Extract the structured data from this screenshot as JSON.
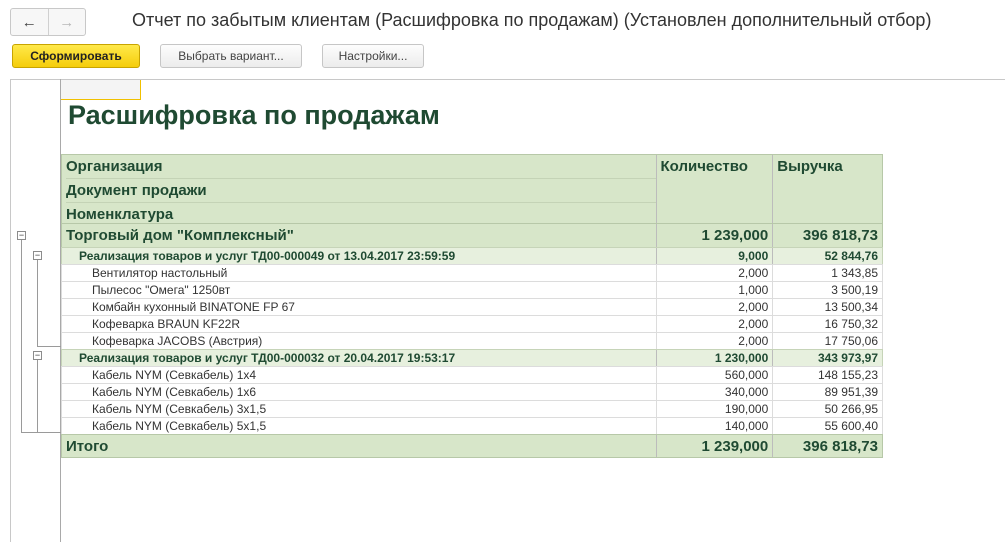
{
  "nav": {
    "back_icon": "arrow-left-icon",
    "forward_icon": "arrow-right-icon",
    "back_glyph": "←",
    "forward_glyph": "→"
  },
  "window": {
    "title": "Отчет по забытым клиентам (Расшифровка по продажам) (Установлен дополнительный отбор)"
  },
  "toolbar": {
    "generate_label": "Сформировать",
    "choose_variant_label": "Выбрать вариант...",
    "settings_label": "Настройки..."
  },
  "report": {
    "title": "Расшифровка по продажам",
    "header": {
      "organization": "Организация",
      "sale_document": "Документ продажи",
      "nomenclature": "Номенклатура",
      "quantity": "Количество",
      "revenue": "Выручка"
    },
    "group": {
      "name": "Торговый дом \"Комплексный\"",
      "quantity": "1 239,000",
      "revenue": "396 818,73"
    },
    "documents": [
      {
        "name": "Реализация товаров и услуг ТД00-000049 от 13.04.2017 23:59:59",
        "quantity": "9,000",
        "revenue": "52 844,76",
        "items": [
          {
            "name": "Вентилятор настольный",
            "quantity": "2,000",
            "revenue": "1 343,85"
          },
          {
            "name": "Пылесос \"Омега\" 1250вт",
            "quantity": "1,000",
            "revenue": "3 500,19"
          },
          {
            "name": "Комбайн кухонный BINATONE FP 67",
            "quantity": "2,000",
            "revenue": "13 500,34"
          },
          {
            "name": "Кофеварка BRAUN KF22R",
            "quantity": "2,000",
            "revenue": "16 750,32"
          },
          {
            "name": "Кофеварка JACOBS (Австрия)",
            "quantity": "2,000",
            "revenue": "17 750,06"
          }
        ]
      },
      {
        "name": "Реализация товаров и услуг ТД00-000032 от 20.04.2017 19:53:17",
        "quantity": "1 230,000",
        "revenue": "343 973,97",
        "items": [
          {
            "name": "Кабель NYM (Севкабель) 1х4",
            "quantity": "560,000",
            "revenue": "148 155,23"
          },
          {
            "name": "Кабель NYM (Севкабель) 1х6",
            "quantity": "340,000",
            "revenue": "89 951,39"
          },
          {
            "name": "Кабель NYM (Севкабель) 3х1,5",
            "quantity": "190,000",
            "revenue": "50 266,95"
          },
          {
            "name": "Кабель NYM (Севкабель) 5х1,5",
            "quantity": "140,000",
            "revenue": "55 600,40"
          }
        ]
      }
    ],
    "total": {
      "label": "Итого",
      "quantity": "1 239,000",
      "revenue": "396 818,73"
    }
  },
  "tree": {
    "collapse_glyph": "−"
  }
}
